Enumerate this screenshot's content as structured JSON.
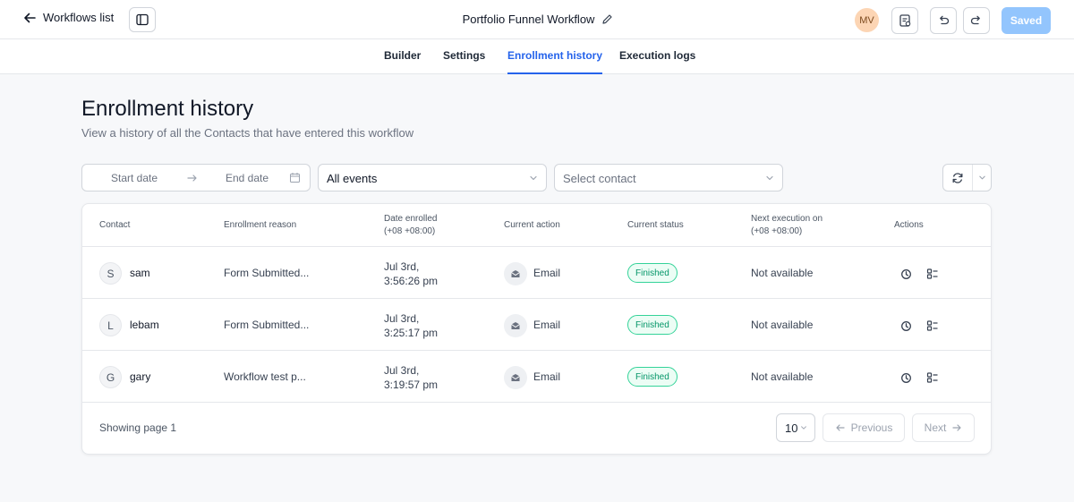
{
  "topbar": {
    "back_label": "Workflows list",
    "workflow_title": "Portfolio Funnel Workflow",
    "avatar_initials": "MV",
    "saved_label": "Saved"
  },
  "tabs": [
    {
      "label": "Builder",
      "active": false
    },
    {
      "label": "Settings",
      "active": false
    },
    {
      "label": "Enrollment history",
      "active": true
    },
    {
      "label": "Execution logs",
      "active": false
    }
  ],
  "header": {
    "title": "Enrollment history",
    "subtitle": "View a history of all the Contacts that have entered this workflow"
  },
  "filters": {
    "start_date_placeholder": "Start date",
    "end_date_placeholder": "End date",
    "events_select": "All events",
    "contact_select_placeholder": "Select contact"
  },
  "table": {
    "columns": {
      "contact": "Contact",
      "reason": "Enrollment reason",
      "date_line1": "Date enrolled",
      "date_line2": "(+08 +08:00)",
      "action": "Current action",
      "status": "Current status",
      "next_line1": "Next execution on",
      "next_line2": "(+08 +08:00)",
      "actions": "Actions"
    },
    "rows": [
      {
        "initial": "S",
        "name": "sam",
        "reason": "Form Submitted...",
        "date_line1": "Jul 3rd,",
        "date_line2": "3:56:26 pm",
        "action": "Email",
        "status": "Finished",
        "next": "Not available"
      },
      {
        "initial": "L",
        "name": "lebam",
        "reason": "Form Submitted...",
        "date_line1": "Jul 3rd,",
        "date_line2": "3:25:17 pm",
        "action": "Email",
        "status": "Finished",
        "next": "Not available"
      },
      {
        "initial": "G",
        "name": "gary",
        "reason": "Workflow test p...",
        "date_line1": "Jul 3rd,",
        "date_line2": "3:19:57 pm",
        "action": "Email",
        "status": "Finished",
        "next": "Not available"
      }
    ]
  },
  "pagination": {
    "showing": "Showing page 1",
    "page_size": "10",
    "previous": "Previous",
    "next": "Next"
  },
  "colors": {
    "accent": "#2563eb",
    "saved_button": "#93c5fd",
    "status_green": "#059669"
  },
  "icons": {
    "back": "arrow-left-icon",
    "sidebar": "sidebar-panel-icon",
    "edit": "pencil-icon",
    "notes": "clipboard-list-icon",
    "undo": "undo-icon",
    "redo": "redo-icon",
    "calendar": "calendar-icon",
    "refresh": "refresh-icon",
    "email": "envelope-icon",
    "history": "clock-history-icon",
    "details": "list-details-icon"
  }
}
